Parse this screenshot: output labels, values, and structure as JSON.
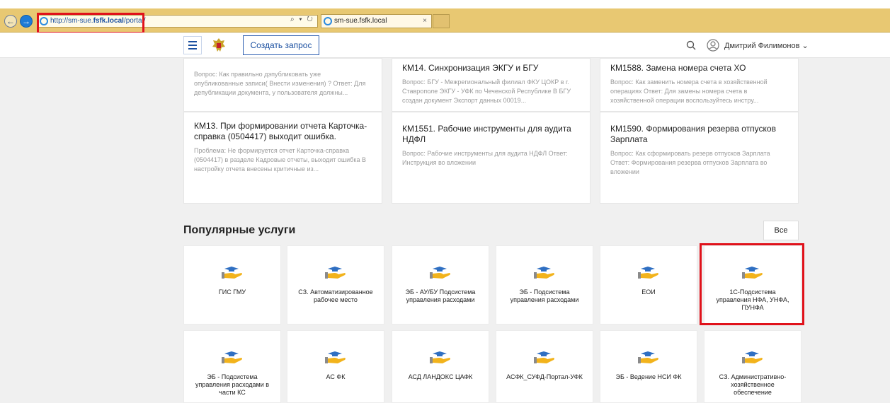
{
  "browser": {
    "url_prefix": "http://sm-sue.",
    "url_host": "fsfk.local",
    "url_suffix": "/portal/",
    "addr_tools": "⌕ ▾ ↻",
    "tab_title": "sm-sue.fsfk.local",
    "tab_close": "×"
  },
  "header": {
    "create_label": "Создать запрос",
    "user_name": "Дмитрий Филимонов",
    "user_chevron": "⌄"
  },
  "knowledge_cards": [
    {
      "title": "",
      "text": "Вопрос: Как правильно дэпубликовать уже опубликованные записи( Внести изменения) ? Ответ: Для депубликации документа, у пользователя должны..."
    },
    {
      "title": "КМ14. Синхронизация ЭКГУ и БГУ",
      "text": "Вопрос: БГУ - Межрегиональный филиал ФКУ ЦОКР в г. Ставрополе ЭКГУ - УФК по Чеченской Республике В БГУ создан документ Экспорт данных 00019..."
    },
    {
      "title": "КМ1588. Замена номера счета ХО",
      "text": "Вопрос: Как заменить номера счета в хозяйственной операциях Ответ: Для замены номера счета в хозяйственной операции воспользуйтесь инстру..."
    },
    {
      "title": "КМ13. При формировании отчета Карточка-справка (0504417) выходит ошибка.",
      "text": "Проблема: Не формируется отчет Карточка-справка (0504417) в разделе Кадровые отчеты, выходит ошибка В настройку отчета внесены критичные из..."
    },
    {
      "title": "КМ1551. Рабочие инструменты для аудита НДФЛ",
      "text": "Вопрос: Рабочие инструменты для аудита НДФЛ Ответ: Инструкция во вложении"
    },
    {
      "title": "КМ1590. Формирования резерва отпусков Зарплата",
      "text": "Вопрос: Как сформировать резерв отпусков Зарплата Ответ: Формирования резерва отпусков Зарплата во вложении"
    }
  ],
  "services": {
    "title": "Популярные услуги",
    "all_label": "Все",
    "tiles": [
      "ГИС ГМУ",
      "СЗ. Автоматизированное рабочее место",
      "ЭБ - АУ/БУ Подсистема управления расходами",
      "ЭБ - Подсистема управления расходами",
      "ЕОИ",
      "1С-Подсистема управления НФА, УНФА, ПУНФА",
      "ЭБ - Подсистема управления расходами в части КС",
      "АС ФК",
      "АСД ЛАНДОКС ЦАФК",
      "АСФК_СУФД-Портал-УФК",
      "ЭБ - Ведение НСИ ФК",
      "СЗ. Административно-хозяйственное обеспечение"
    ]
  },
  "colors": {
    "browser_bar": "#e8c872",
    "accent": "#1a4fa0",
    "highlight": "#e0121b"
  }
}
